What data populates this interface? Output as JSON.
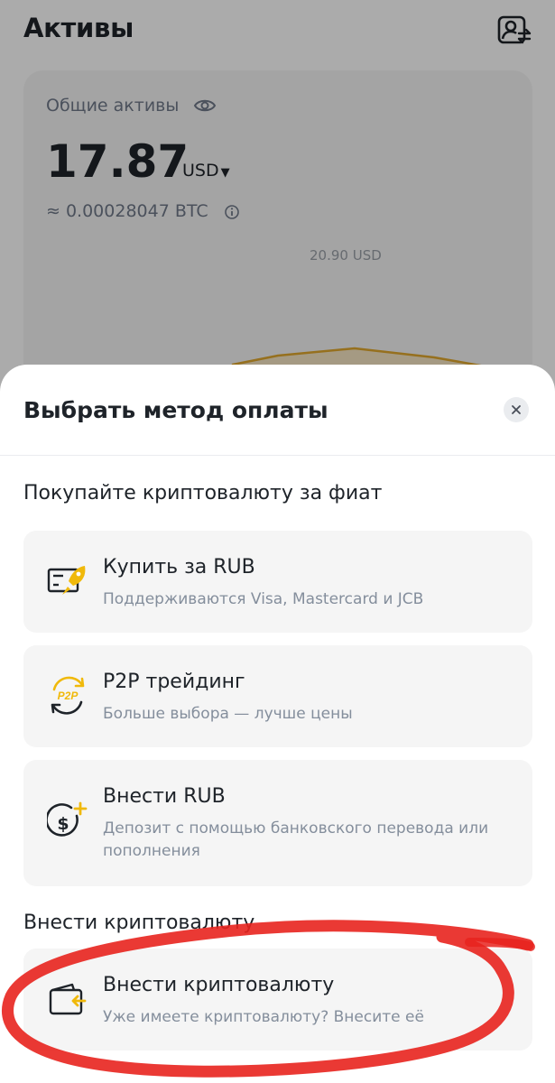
{
  "background": {
    "title": "Активы",
    "assets_label": "Общие активы",
    "total_value": "17.87",
    "currency": "USD",
    "btc_value": "≈ 0.00028047 BTC",
    "chart_peak_label": "20.90 USD",
    "chart_color": "#E0A82E",
    "icons": [
      "account-switch-icon",
      "eye-icon",
      "info-icon",
      "caret-down-icon"
    ]
  },
  "sheet": {
    "title": "Выбрать метод оплаты",
    "close_icon": "close-icon",
    "fiat_section": {
      "title": "Покупайте криптовалюту за фиат",
      "options": [
        {
          "title": "Купить за RUB",
          "subtitle": "Поддерживаются Visa, Mastercard и JCB",
          "icon": "card-rocket-icon"
        },
        {
          "title": "P2P трейдинг",
          "subtitle": "Больше выбора — лучше цены",
          "icon": "p2p-icon"
        },
        {
          "title": "Внести RUB",
          "subtitle": "Депозит с помощью банковского перевода или пополнения",
          "icon": "dollar-plus-icon"
        }
      ]
    },
    "crypto_section": {
      "title": "Внести криптовалюту",
      "options": [
        {
          "title": "Внести криптовалюту",
          "subtitle": "Уже имеете криптовалюту? Внесите её",
          "icon": "wallet-deposit-icon"
        }
      ]
    }
  },
  "colors": {
    "accent": "#F0B90B",
    "text_primary": "#1E2329",
    "text_secondary": "#848E9C",
    "card_bg": "#F5F5F5",
    "highlight_marker": "#E8231E"
  }
}
